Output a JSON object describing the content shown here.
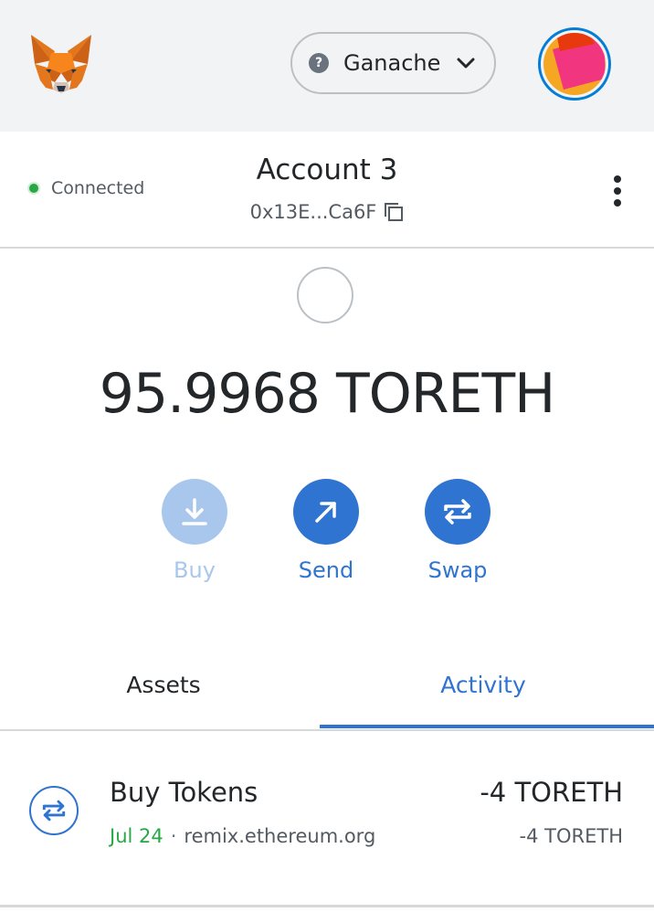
{
  "header": {
    "network": {
      "icon": "question-icon",
      "label": "Ganache",
      "help_glyph": "?"
    }
  },
  "account": {
    "status": "Connected",
    "name": "Account 3",
    "address": "0x13E...Ca6F"
  },
  "balance": {
    "text": "95.9968 TORETH"
  },
  "actions": [
    {
      "label": "Buy",
      "icon": "download-icon",
      "enabled": false
    },
    {
      "label": "Send",
      "icon": "arrow-up-right-icon",
      "enabled": true
    },
    {
      "label": "Swap",
      "icon": "swap-icon",
      "enabled": true
    }
  ],
  "tabs": [
    {
      "label": "Assets",
      "active": false
    },
    {
      "label": "Activity",
      "active": true
    }
  ],
  "activity": [
    {
      "title": "Buy Tokens",
      "date": "Jul 24",
      "separator": "·",
      "origin": "remix.ethereum.org",
      "amount_primary": "-4 TORETH",
      "amount_secondary": "-4 TORETH",
      "icon": "swap-icon"
    }
  ],
  "colors": {
    "accent": "#2f74d0",
    "accent_disabled": "#a9c7ec",
    "connected": "#28a745",
    "header_bg": "#f2f3f4"
  }
}
